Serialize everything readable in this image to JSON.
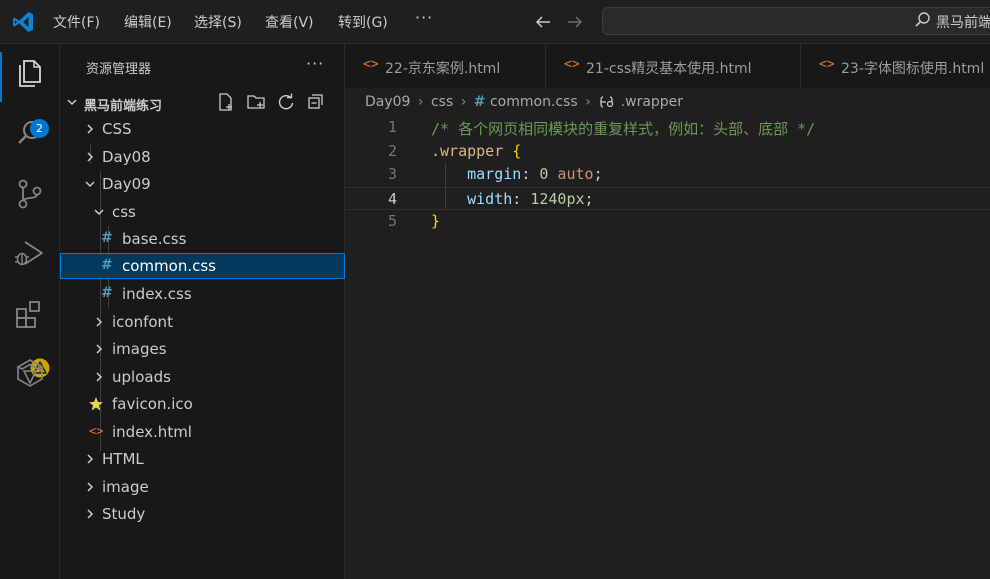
{
  "titlebar": {
    "menus": [
      "文件(F)",
      "编辑(E)",
      "选择(S)",
      "查看(V)",
      "转到(G)"
    ],
    "more": "···",
    "back_icon": "arrow-left-icon",
    "forward_icon": "arrow-right-icon",
    "command_center_text": "黑马前端"
  },
  "activitybar": {
    "items": [
      "explorer",
      "search",
      "source-control",
      "run-debug",
      "extensions",
      "remote"
    ],
    "explorer_badge": "2",
    "accent": "#0078d4",
    "warning_color": "#cca700"
  },
  "sidebar": {
    "title": "资源管理器",
    "more": "···",
    "root": "黑马前端练习",
    "tree": [
      {
        "label": "CSS",
        "type": "folder",
        "expanded": false
      },
      {
        "label": "Day08",
        "type": "folder",
        "expanded": false
      },
      {
        "label": "Day09",
        "type": "folder",
        "expanded": true
      },
      {
        "label": "css",
        "type": "folder",
        "expanded": true
      },
      {
        "label": "base.css",
        "type": "css"
      },
      {
        "label": "common.css",
        "type": "css",
        "selected": true
      },
      {
        "label": "index.css",
        "type": "css"
      },
      {
        "label": "iconfont",
        "type": "folder",
        "expanded": false
      },
      {
        "label": "images",
        "type": "folder",
        "expanded": false
      },
      {
        "label": "uploads",
        "type": "folder",
        "expanded": false
      },
      {
        "label": "favicon.ico",
        "type": "ico"
      },
      {
        "label": "index.html",
        "type": "html"
      },
      {
        "label": "HTML",
        "type": "folder",
        "expanded": false
      },
      {
        "label": "image",
        "type": "folder",
        "expanded": false
      },
      {
        "label": "Study",
        "type": "folder",
        "expanded": false
      }
    ]
  },
  "editor": {
    "tabs": [
      {
        "label": "22-京东案例.html"
      },
      {
        "label": "21-css精灵基本使用.html"
      },
      {
        "label": "23-字体图标使用.html"
      }
    ],
    "breadcrumb": [
      "Day09",
      "css",
      "common.css",
      ".wrapper"
    ],
    "line_numbers": [
      "1",
      "2",
      "3",
      "4",
      "5"
    ],
    "active_line": "4",
    "code": {
      "l1": "/* 各个网页相同模块的重复样式，例如：头部、底部 */",
      "l2_selector": ".wrapper",
      "l2_brace": "{",
      "l3_prop": "margin",
      "l3_colon": ": ",
      "l3_num": "0",
      "l3_val": " auto",
      "l3_semi": ";",
      "l4_prop": "width",
      "l4_colon": ": ",
      "l4_num": "1240px",
      "l4_semi": ";",
      "l5_brace": "}"
    }
  }
}
